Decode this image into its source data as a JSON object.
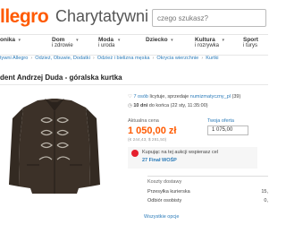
{
  "header": {
    "logo": "llegro",
    "brand": "Charytatywni",
    "search_placeholder": "czego szukasz?"
  },
  "categories": [
    {
      "line1": "onika",
      "line2": ""
    },
    {
      "line1": "Dom",
      "line2": "i zdrowie"
    },
    {
      "line1": "Moda",
      "line2": "i uroda"
    },
    {
      "line1": "Dziecko",
      "line2": ""
    },
    {
      "line1": "Kultura",
      "line2": "i rozrywka"
    },
    {
      "line1": "Sport",
      "line2": "i turys"
    }
  ],
  "breadcrumb": [
    "tywni Allegro",
    "Odzież, Obuwie, Dodatki",
    "Odzież i bielizna męska",
    "Okrycia wierzchnie",
    "Kurtki"
  ],
  "item": {
    "title": "dent Andrzej Duda - góralska kurtka"
  },
  "seller": {
    "watchers": "7 osób",
    "watchers_suffix": "licytuje, sprzedaje",
    "user": "numizmatyczny_pl",
    "rating": "(39)",
    "timer_days": "10 dni",
    "timer_rest": "do końca (22 sty, 11:35:00)"
  },
  "price": {
    "label": "Aktualna cena",
    "value": "1 050,00 zł",
    "sub": "(€ 244,43, $ 281,50)"
  },
  "offer": {
    "label": "Twoja oferta",
    "value": "1 075,00"
  },
  "charity": {
    "line1": "Kupując na tej aukcji wspierasz cel",
    "link": "27 Finał WOŚP"
  },
  "shipping": {
    "title": "Koszty dostawy",
    "rows": [
      {
        "label": "Przesyłka kurierska",
        "value": "15,"
      },
      {
        "label": "Odbiór osobisty",
        "value": "0,"
      }
    ],
    "more": "Wszystkie opcje"
  }
}
